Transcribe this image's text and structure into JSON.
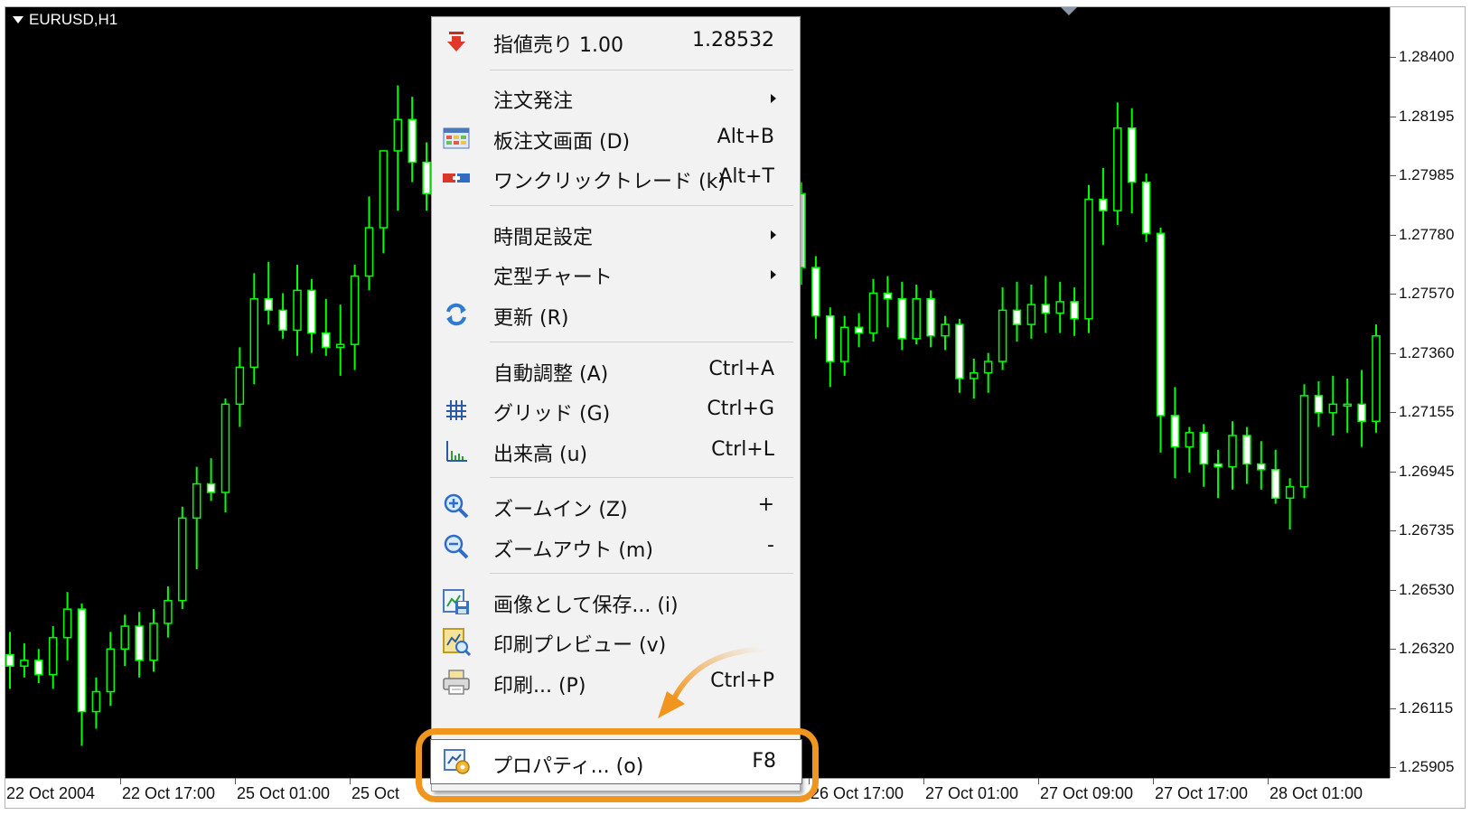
{
  "chart": {
    "symbol": "EURUSD,H1",
    "background": "#000000",
    "candle_color": "#00ff00",
    "bull_body_color": "#000000",
    "bear_body_color": "#ffffff",
    "price_levels": [
      "1.28400",
      "1.28195",
      "1.27985",
      "1.27780",
      "1.27570",
      "1.27360",
      "1.27155",
      "1.26945",
      "1.26735",
      "1.26530",
      "1.26320",
      "1.26115",
      "1.25905"
    ],
    "time_labels": [
      "22 Oct 2004",
      "22 Oct 17:00",
      "25 Oct 01:00",
      "25 Oct",
      "26 Oct 17:00",
      "27 Oct 01:00",
      "27 Oct 09:00",
      "27 Oct 17:00",
      "28 Oct 01:00"
    ]
  },
  "chart_data": {
    "type": "candlestick",
    "title": "EURUSD,H1",
    "ylim": [
      1.25905,
      1.284
    ],
    "x_tick_labels": [
      "22 Oct 2004",
      "22 Oct 17:00",
      "25 Oct 01:00",
      "25 Oct",
      "26 Oct 17:00",
      "27 Oct 01:00",
      "27 Oct 09:00",
      "27 Oct 17:00",
      "28 Oct 01:00"
    ],
    "y_tick_labels": [
      "1.28400",
      "1.28195",
      "1.27985",
      "1.27780",
      "1.27570",
      "1.27360",
      "1.27155",
      "1.26945",
      "1.26735",
      "1.26530",
      "1.26320",
      "1.26115",
      "1.25905"
    ],
    "left_candles": [
      [
        1.263,
        1.2638,
        1.2618,
        1.2626
      ],
      [
        1.2626,
        1.2634,
        1.2622,
        1.2628
      ],
      [
        1.2628,
        1.2632,
        1.262,
        1.2623
      ],
      [
        1.2623,
        1.264,
        1.2618,
        1.2636
      ],
      [
        1.2636,
        1.2652,
        1.2628,
        1.2646
      ],
      [
        1.2646,
        1.2648,
        1.2598,
        1.261
      ],
      [
        1.261,
        1.2622,
        1.2604,
        1.2617
      ],
      [
        1.2617,
        1.2638,
        1.2612,
        1.2632
      ],
      [
        1.2632,
        1.2644,
        1.2626,
        1.264
      ],
      [
        1.264,
        1.2645,
        1.2622,
        1.2628
      ],
      [
        1.2628,
        1.2646,
        1.2624,
        1.2641
      ],
      [
        1.2641,
        1.2654,
        1.2636,
        1.2649
      ],
      [
        1.2649,
        1.2682,
        1.2646,
        1.2678
      ],
      [
        1.2678,
        1.2696,
        1.266,
        1.269
      ],
      [
        1.269,
        1.2699,
        1.2684,
        1.2687
      ],
      [
        1.2687,
        1.272,
        1.268,
        1.2718
      ],
      [
        1.2718,
        1.2738,
        1.271,
        1.2731
      ],
      [
        1.2731,
        1.2764,
        1.2725,
        1.2755
      ],
      [
        1.2755,
        1.2768,
        1.2746,
        1.2751
      ],
      [
        1.2751,
        1.2757,
        1.2741,
        1.2744
      ],
      [
        1.2744,
        1.2767,
        1.2735,
        1.2758
      ],
      [
        1.2758,
        1.2762,
        1.2736,
        1.2743
      ],
      [
        1.2743,
        1.2755,
        1.2735,
        1.2738
      ],
      [
        1.2738,
        1.2753,
        1.2728,
        1.2739
      ],
      [
        1.2739,
        1.2767,
        1.273,
        1.2763
      ],
      [
        1.2763,
        1.2791,
        1.2758,
        1.278
      ],
      [
        1.278,
        1.2805,
        1.2771,
        1.2807
      ],
      [
        1.2807,
        1.283,
        1.2786,
        1.2818
      ],
      [
        1.2818,
        1.2826,
        1.2796,
        1.2803
      ],
      [
        1.2803,
        1.281,
        1.2786,
        1.2792
      ],
      [
        1.2792,
        1.28,
        1.2776,
        1.2785
      ]
    ],
    "right_candles": [
      [
        1.2792,
        1.2796,
        1.276,
        1.2766
      ],
      [
        1.2766,
        1.277,
        1.2741,
        1.2749
      ],
      [
        1.2749,
        1.2752,
        1.2724,
        1.2733
      ],
      [
        1.2733,
        1.2749,
        1.2728,
        1.2745
      ],
      [
        1.2745,
        1.275,
        1.2738,
        1.2743
      ],
      [
        1.2743,
        1.2762,
        1.274,
        1.2757
      ],
      [
        1.2757,
        1.2763,
        1.2745,
        1.2755
      ],
      [
        1.2755,
        1.2761,
        1.2737,
        1.2741
      ],
      [
        1.2741,
        1.276,
        1.2739,
        1.2755
      ],
      [
        1.2755,
        1.2758,
        1.2738,
        1.2742
      ],
      [
        1.2742,
        1.2749,
        1.2737,
        1.2746
      ],
      [
        1.2746,
        1.2748,
        1.2722,
        1.2727
      ],
      [
        1.2727,
        1.2734,
        1.272,
        1.2729
      ],
      [
        1.2729,
        1.2736,
        1.2722,
        1.2733
      ],
      [
        1.2733,
        1.2759,
        1.273,
        1.2751
      ],
      [
        1.2751,
        1.2761,
        1.274,
        1.2746
      ],
      [
        1.2746,
        1.276,
        1.2741,
        1.2753
      ],
      [
        1.2753,
        1.2763,
        1.2743,
        1.275
      ],
      [
        1.275,
        1.2761,
        1.2743,
        1.2754
      ],
      [
        1.2754,
        1.2759,
        1.2742,
        1.2748
      ],
      [
        1.2748,
        1.2795,
        1.2743,
        1.279
      ],
      [
        1.279,
        1.2801,
        1.2774,
        1.2786
      ],
      [
        1.2786,
        1.2824,
        1.2781,
        1.2815
      ],
      [
        1.2815,
        1.2822,
        1.2785,
        1.2796
      ],
      [
        1.2796,
        1.2799,
        1.2775,
        1.2778
      ],
      [
        1.2778,
        1.278,
        1.2701,
        1.2714
      ],
      [
        1.2714,
        1.2724,
        1.2692,
        1.2703
      ],
      [
        1.2703,
        1.271,
        1.2694,
        1.2708
      ],
      [
        1.2708,
        1.2711,
        1.2689,
        1.2697
      ],
      [
        1.2697,
        1.2702,
        1.2685,
        1.2696
      ],
      [
        1.2696,
        1.2712,
        1.2688,
        1.2707
      ],
      [
        1.2707,
        1.271,
        1.269,
        1.2697
      ],
      [
        1.2697,
        1.2705,
        1.2688,
        1.2695
      ],
      [
        1.2695,
        1.2702,
        1.2683,
        1.2685
      ],
      [
        1.2685,
        1.2692,
        1.2674,
        1.2689
      ],
      [
        1.2689,
        1.2725,
        1.2685,
        1.2721
      ],
      [
        1.2721,
        1.2726,
        1.271,
        1.2715
      ],
      [
        1.2715,
        1.2728,
        1.2707,
        1.2718
      ],
      [
        1.2718,
        1.2727,
        1.2708,
        1.2718
      ],
      [
        1.2718,
        1.273,
        1.2703,
        1.2712
      ],
      [
        1.2712,
        1.2746,
        1.2708,
        1.2742
      ]
    ]
  },
  "menu": {
    "items": [
      {
        "id": "sell-limit",
        "icon": "sell-arrow-icon",
        "label": "指値売り 1.00",
        "shortcut": "1.28532"
      },
      {
        "id": "new-order",
        "label": "注文発注",
        "submenu": true
      },
      {
        "id": "trade-board",
        "icon": "trade-board-icon",
        "label": "板注文画面 (D)",
        "shortcut": "Alt+B"
      },
      {
        "id": "one-click",
        "icon": "one-click-icon",
        "label": "ワンクリックトレード (k)",
        "shortcut": "Alt+T"
      },
      {
        "id": "timeframes",
        "label": "時間足設定",
        "submenu": true
      },
      {
        "id": "templates",
        "label": "定型チャート",
        "submenu": true
      },
      {
        "id": "refresh",
        "icon": "refresh-icon",
        "label": "更新 (R)"
      },
      {
        "id": "autoscroll",
        "label": "自動調整 (A)",
        "shortcut": "Ctrl+A"
      },
      {
        "id": "grid",
        "icon": "grid-icon",
        "label": "グリッド (G)",
        "shortcut": "Ctrl+G"
      },
      {
        "id": "volumes",
        "icon": "volumes-icon",
        "label": "出来高 (u)",
        "shortcut": "Ctrl+L"
      },
      {
        "id": "zoom-in",
        "icon": "zoom-in-icon",
        "label": "ズームイン (Z)",
        "shortcut": "+"
      },
      {
        "id": "zoom-out",
        "icon": "zoom-out-icon",
        "label": "ズームアウト (m)",
        "shortcut": "-"
      },
      {
        "id": "save-as-picture",
        "icon": "save-picture-icon",
        "label": "画像として保存... (i)"
      },
      {
        "id": "print-preview",
        "icon": "print-preview-icon",
        "label": "印刷プレビュー (v)"
      },
      {
        "id": "print",
        "icon": "printer-icon",
        "label": "印刷... (P)",
        "shortcut": "Ctrl+P"
      },
      {
        "id": "properties",
        "icon": "properties-icon",
        "label": "プロパティ... (o)",
        "shortcut": "F8"
      }
    ]
  },
  "annotation": {
    "highlight_color": "#f0961e",
    "target": "properties"
  }
}
